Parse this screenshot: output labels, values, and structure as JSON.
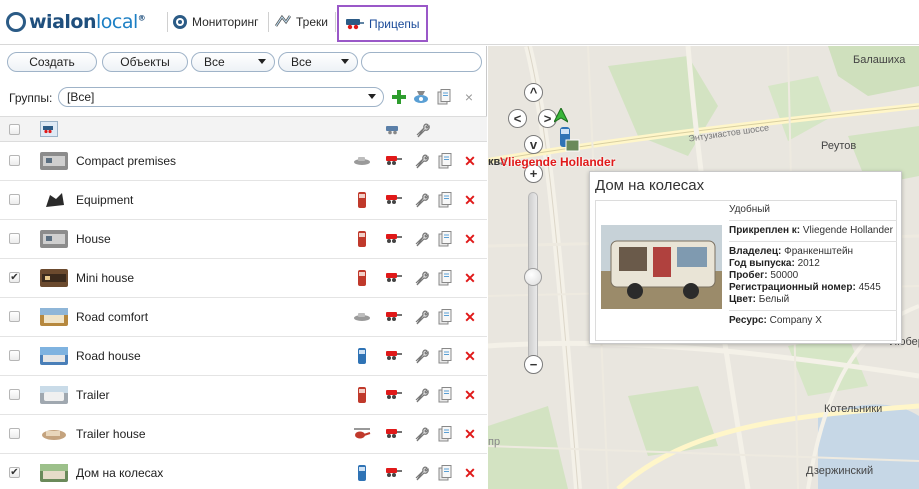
{
  "app": {
    "logo_text_a": "wialon",
    "logo_text_b": "local",
    "logo_mark": "®"
  },
  "nav": {
    "items": [
      {
        "label": "Мониторинг",
        "icon": "monitoring-icon"
      },
      {
        "label": "Треки",
        "icon": "tracks-icon"
      },
      {
        "label": "Прицепы",
        "icon": "trailer-icon",
        "active": true
      }
    ]
  },
  "toolbar": {
    "create_label": "Создать",
    "filter_objects_label": "Объекты",
    "filter_all_1": "Все",
    "filter_all_2": "Все",
    "search_value": ""
  },
  "groups": {
    "label": "Группы:",
    "selected": "[Все]"
  },
  "rows": [
    {
      "name": "Compact premises",
      "checked": false,
      "unit_type": "car",
      "thumb_color": "#8c8c8c"
    },
    {
      "name": "Equipment",
      "checked": false,
      "unit_type": "truck",
      "thumb_color": "#2a2a2a"
    },
    {
      "name": "House",
      "checked": false,
      "unit_type": "truck",
      "thumb_color": "#8c8c8c"
    },
    {
      "name": "Mini house",
      "checked": true,
      "unit_type": "truck",
      "thumb_color": "#6b4a2e"
    },
    {
      "name": "Road comfort",
      "checked": false,
      "unit_type": "car",
      "thumb_color": "#b6883e"
    },
    {
      "name": "Road house",
      "checked": false,
      "unit_type": "van",
      "thumb_color": "#4a7fb8"
    },
    {
      "name": "Trailer",
      "checked": false,
      "unit_type": "truck",
      "thumb_color": "#a0a8b0"
    },
    {
      "name": "Trailer house",
      "checked": false,
      "unit_type": "helicopter",
      "thumb_color": "#c4a37e"
    },
    {
      "name": "Дом на колесах",
      "checked": true,
      "unit_type": "van",
      "thumb_color": "#6a8a5a"
    }
  ],
  "map": {
    "labels": {
      "balashikha": "Балашиха",
      "reutov": "Реутов",
      "highway": "Энтузиастов шоссе",
      "lyuberts": "Люберц",
      "kotelniki": "Котельники",
      "dzerzhinsky": "Дзержинский",
      "kva": "ква",
      "np": "пр"
    },
    "unit_label": "Vliegende Hollander"
  },
  "popup": {
    "title": "Дом на колесах",
    "status": "Удобный",
    "attached_label": "Прикреплен к:",
    "attached_value": "Vliegende Hollander",
    "owner_label": "Владелец:",
    "owner_value": "Франкенштейн",
    "year_label": "Год выпуска:",
    "year_value": "2012",
    "mileage_label": "Пробег:",
    "mileage_value": "50000",
    "reg_label": "Регистрационный номер:",
    "reg_value": "4545",
    "color_label": "Цвет:",
    "color_value": "Белый",
    "resource_label": "Ресурс:",
    "resource_value": "Company X"
  },
  "colors": {
    "accent": "#9a58c8",
    "delete": "#e01919",
    "add": "#2e9d2e",
    "logo": "#1f4f7d"
  }
}
